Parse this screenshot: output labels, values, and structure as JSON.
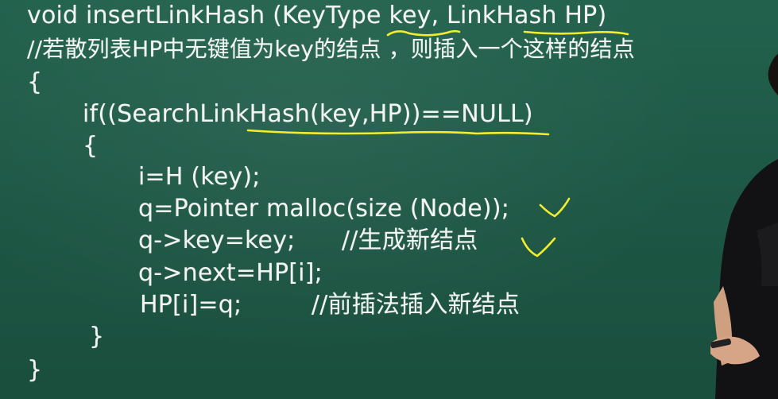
{
  "code_lines": [
    "void insertLinkHash (KeyType key, LinkHash HP)",
    "//若散列表HP中无键值为key的结点 ，则插入一个这样的结点",
    "{",
    "if((SearchLinkHash(key,HP))==NULL)",
    "{",
    "i=H (key);",
    "q=Pointer malloc(size (Node));",
    "q->key=key;      //生成新结点",
    "q->next=HP[i];",
    "HP[i]=q;         //前插法插入新结点",
    "}",
    "}"
  ],
  "colors": {
    "chalkboard": "#1f5a46",
    "chalk_text": "#f3f5f2",
    "yellow_marker": "#f4ee2a"
  },
  "annotations": [
    "underline-key",
    "underline-hash-hp",
    "underline-if-condition",
    "checkmark-malloc",
    "checkmark-new-node"
  ]
}
